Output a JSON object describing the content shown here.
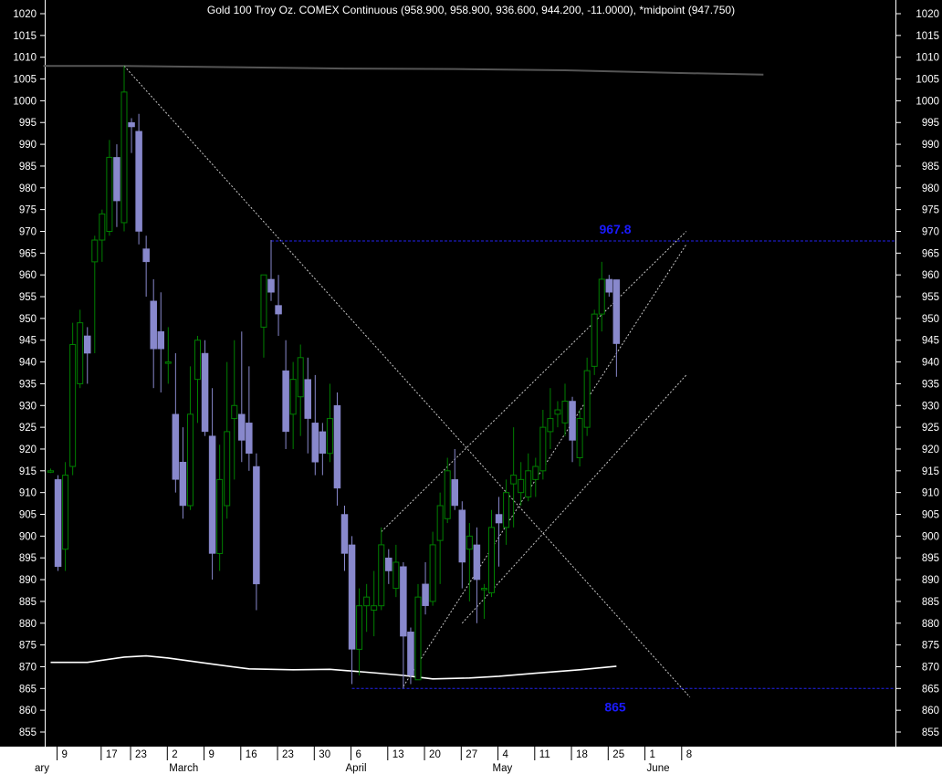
{
  "chart_data": {
    "type": "candlestick",
    "title": "Gold 100 Troy Oz. COMEX Continuous (958.900, 958.900, 936.600, 944.200, -11.0000), *midpoint (947.750)",
    "ylim": [
      851,
      1022
    ],
    "y_ticks": [
      855,
      860,
      865,
      870,
      875,
      880,
      885,
      890,
      895,
      900,
      905,
      910,
      915,
      920,
      925,
      930,
      935,
      940,
      945,
      950,
      955,
      960,
      965,
      970,
      975,
      980,
      985,
      990,
      995,
      1000,
      1005,
      1010,
      1015,
      1020
    ],
    "x_day_ticks": [
      {
        "label": "9",
        "i": 1
      },
      {
        "label": "17",
        "i": 7
      },
      {
        "label": "23",
        "i": 11
      },
      {
        "label": "2",
        "i": 16
      },
      {
        "label": "9",
        "i": 21
      },
      {
        "label": "16",
        "i": 26
      },
      {
        "label": "23",
        "i": 31
      },
      {
        "label": "30",
        "i": 36
      },
      {
        "label": "6",
        "i": 41
      },
      {
        "label": "13",
        "i": 46
      },
      {
        "label": "20",
        "i": 51
      },
      {
        "label": "27",
        "i": 56
      },
      {
        "label": "4",
        "i": 61
      },
      {
        "label": "11",
        "i": 66
      },
      {
        "label": "18",
        "i": 71
      },
      {
        "label": "25",
        "i": 76
      },
      {
        "label": "1",
        "i": 81
      },
      {
        "label": "8",
        "i": 86
      }
    ],
    "x_month_labels": [
      {
        "label": "ary",
        "i": -2.3
      },
      {
        "label": "March",
        "i": 16
      },
      {
        "label": "April",
        "i": 40
      },
      {
        "label": "May",
        "i": 60
      },
      {
        "label": "June",
        "i": 81
      }
    ],
    "colors": {
      "up": "#008000",
      "down": "#8888cc",
      "grid_text": "#ffffff",
      "level_line": "#2222ee",
      "level_text": "#1a1aff",
      "trend_line": "#c8c8c8",
      "moving_average": "#ffffff",
      "long_average": "#555555"
    },
    "candles": [
      {
        "o": 915.0,
        "h": 915.5,
        "l": 914.5,
        "c": 915.0
      },
      {
        "o": 913,
        "h": 914,
        "l": 892,
        "c": 893
      },
      {
        "o": 897,
        "h": 917,
        "l": 892,
        "c": 914
      },
      {
        "o": 916,
        "h": 949,
        "l": 914,
        "c": 944
      },
      {
        "o": 935,
        "h": 952,
        "l": 934,
        "c": 949
      },
      {
        "o": 946,
        "h": 948,
        "l": 935,
        "c": 942
      },
      {
        "o": 963,
        "h": 969,
        "l": 942,
        "c": 968
      },
      {
        "o": 968,
        "h": 975,
        "l": 963,
        "c": 974
      },
      {
        "o": 970,
        "h": 991,
        "l": 969,
        "c": 987
      },
      {
        "o": 987,
        "h": 990,
        "l": 971,
        "c": 977
      },
      {
        "o": 972,
        "h": 1008,
        "l": 970,
        "c": 1002
      },
      {
        "o": 995,
        "h": 996,
        "l": 988,
        "c": 994
      },
      {
        "o": 993,
        "h": 997,
        "l": 967,
        "c": 970
      },
      {
        "o": 966,
        "h": 969,
        "l": 955,
        "c": 963
      },
      {
        "o": 954,
        "h": 959,
        "l": 934,
        "c": 943
      },
      {
        "o": 947,
        "h": 956,
        "l": 933,
        "c": 943
      },
      {
        "o": 940,
        "h": 948,
        "l": 935,
        "c": 940
      },
      {
        "o": 928,
        "h": 942,
        "l": 910,
        "c": 913
      },
      {
        "o": 917,
        "h": 925,
        "l": 904,
        "c": 907
      },
      {
        "o": 907,
        "h": 939,
        "l": 906,
        "c": 928
      },
      {
        "o": 936,
        "h": 946,
        "l": 926,
        "c": 945
      },
      {
        "o": 942,
        "h": 945,
        "l": 923,
        "c": 924
      },
      {
        "o": 923,
        "h": 934,
        "l": 890,
        "c": 896
      },
      {
        "o": 896,
        "h": 921,
        "l": 892,
        "c": 913
      },
      {
        "o": 907,
        "h": 940,
        "l": 904,
        "c": 924
      },
      {
        "o": 927,
        "h": 945,
        "l": 913,
        "c": 930
      },
      {
        "o": 928,
        "h": 947,
        "l": 917,
        "c": 922
      },
      {
        "o": 926,
        "h": 939,
        "l": 915,
        "c": 919
      },
      {
        "o": 916,
        "h": 919,
        "l": 883,
        "c": 889
      },
      {
        "o": 948,
        "h": 960,
        "l": 941,
        "c": 960
      },
      {
        "o": 959,
        "h": 968,
        "l": 954,
        "c": 956
      },
      {
        "o": 953,
        "h": 960,
        "l": 946,
        "c": 951
      },
      {
        "o": 938,
        "h": 945,
        "l": 920,
        "c": 924
      },
      {
        "o": 928,
        "h": 940,
        "l": 920,
        "c": 936
      },
      {
        "o": 932,
        "h": 944,
        "l": 923,
        "c": 941
      },
      {
        "o": 936,
        "h": 941,
        "l": 919,
        "c": 927
      },
      {
        "o": 926,
        "h": 937,
        "l": 914,
        "c": 917
      },
      {
        "o": 924,
        "h": 926,
        "l": 914,
        "c": 919
      },
      {
        "o": 919,
        "h": 935,
        "l": 917,
        "c": 927
      },
      {
        "o": 930,
        "h": 933,
        "l": 907,
        "c": 911
      },
      {
        "o": 905,
        "h": 907,
        "l": 892,
        "c": 896
      },
      {
        "o": 898,
        "h": 900,
        "l": 866,
        "c": 874
      },
      {
        "o": 874,
        "h": 888,
        "l": 868,
        "c": 884
      },
      {
        "o": 884,
        "h": 889,
        "l": 878,
        "c": 886
      },
      {
        "o": 883,
        "h": 892,
        "l": 877,
        "c": 884
      },
      {
        "o": 884,
        "h": 902,
        "l": 883,
        "c": 898
      },
      {
        "o": 895,
        "h": 897,
        "l": 889,
        "c": 892
      },
      {
        "o": 888,
        "h": 898,
        "l": 886,
        "c": 894
      },
      {
        "o": 893,
        "h": 894,
        "l": 865,
        "c": 877
      },
      {
        "o": 878,
        "h": 879,
        "l": 866,
        "c": 868
      },
      {
        "o": 867,
        "h": 889,
        "l": 867,
        "c": 886
      },
      {
        "o": 889,
        "h": 894,
        "l": 882,
        "c": 884
      },
      {
        "o": 885,
        "h": 901,
        "l": 884,
        "c": 898
      },
      {
        "o": 899,
        "h": 910,
        "l": 889,
        "c": 907
      },
      {
        "o": 904,
        "h": 918,
        "l": 903,
        "c": 915
      },
      {
        "o": 913,
        "h": 920,
        "l": 906,
        "c": 907
      },
      {
        "o": 906,
        "h": 908,
        "l": 888,
        "c": 894
      },
      {
        "o": 897,
        "h": 903,
        "l": 885,
        "c": 900
      },
      {
        "o": 898,
        "h": 902,
        "l": 880,
        "c": 890
      },
      {
        "o": 888,
        "h": 889,
        "l": 881,
        "c": 888
      },
      {
        "o": 887,
        "h": 906,
        "l": 886,
        "c": 902
      },
      {
        "o": 905,
        "h": 909,
        "l": 893,
        "c": 903
      },
      {
        "o": 902,
        "h": 913,
        "l": 898,
        "c": 910
      },
      {
        "o": 912,
        "h": 925,
        "l": 902,
        "c": 914
      },
      {
        "o": 910,
        "h": 917,
        "l": 907,
        "c": 913
      },
      {
        "o": 909,
        "h": 919,
        "l": 908,
        "c": 915
      },
      {
        "o": 913,
        "h": 918,
        "l": 909,
        "c": 916
      },
      {
        "o": 915,
        "h": 929,
        "l": 913,
        "c": 925
      },
      {
        "o": 924,
        "h": 934,
        "l": 920,
        "c": 927
      },
      {
        "o": 928,
        "h": 931,
        "l": 925,
        "c": 929
      },
      {
        "o": 926,
        "h": 935,
        "l": 923,
        "c": 931
      },
      {
        "o": 931,
        "h": 932,
        "l": 917,
        "c": 922
      },
      {
        "o": 918,
        "h": 929,
        "l": 916,
        "c": 927
      },
      {
        "o": 925,
        "h": 941,
        "l": 923,
        "c": 938
      },
      {
        "o": 939,
        "h": 952,
        "l": 937,
        "c": 951
      },
      {
        "o": 951,
        "h": 963,
        "l": 947,
        "c": 959
      },
      {
        "o": 959,
        "h": 960,
        "l": 955,
        "c": 956
      },
      {
        "o": 958.9,
        "h": 958.9,
        "l": 936.6,
        "c": 944.2
      }
    ],
    "moving_average": [
      [
        0,
        871
      ],
      [
        5,
        871
      ],
      [
        10,
        872.2
      ],
      [
        13,
        872.5
      ],
      [
        16,
        872
      ],
      [
        22,
        870.6
      ],
      [
        27,
        869.5
      ],
      [
        33,
        869.3
      ],
      [
        38,
        869.4
      ],
      [
        44,
        868.6
      ],
      [
        48,
        868
      ],
      [
        52,
        867.2
      ],
      [
        57,
        867.4
      ],
      [
        61,
        867.8
      ],
      [
        66,
        868.5
      ],
      [
        72,
        869.3
      ],
      [
        77,
        870.1
      ]
    ],
    "long_average": [
      [
        -1,
        1008
      ],
      [
        10,
        1008
      ],
      [
        25,
        1007.7
      ],
      [
        40,
        1007.4
      ],
      [
        55,
        1007.3
      ],
      [
        70,
        1007.0
      ],
      [
        85,
        1006.4
      ],
      [
        97,
        1006.0
      ]
    ],
    "levels": [
      {
        "value": 967.8,
        "label": "967.8",
        "from_i": 30
      },
      {
        "value": 865,
        "label": "865",
        "from_i": 41
      }
    ],
    "trend_lines": [
      [
        [
          10,
          1008
        ],
        [
          87,
          863
        ]
      ],
      [
        [
          45,
          901
        ],
        [
          86.5,
          970
        ]
      ],
      [
        [
          48,
          865.5
        ],
        [
          86.5,
          967
        ]
      ],
      [
        [
          56,
          880
        ],
        [
          86.5,
          937
        ]
      ]
    ]
  }
}
